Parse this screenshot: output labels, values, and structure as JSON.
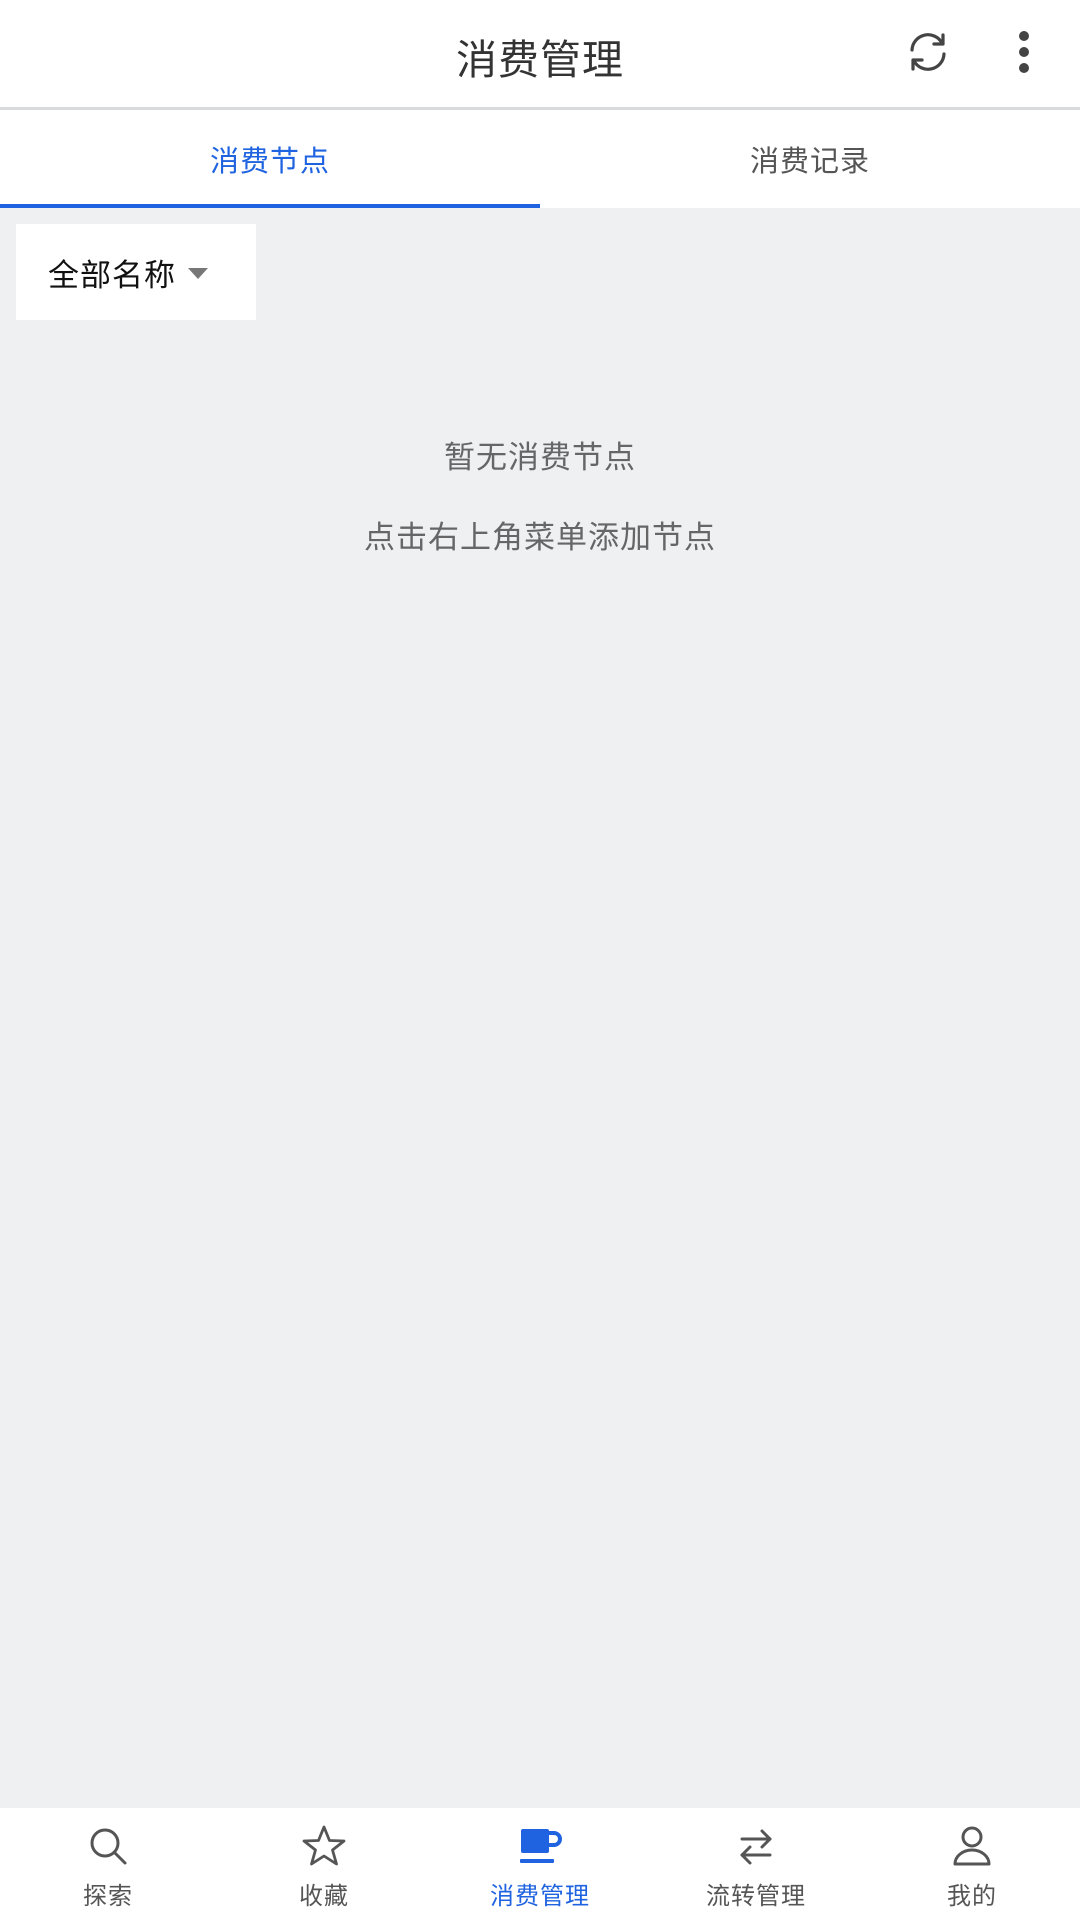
{
  "header": {
    "title": "消费管理",
    "refresh_icon": "refresh-icon",
    "more_icon": "more-vertical-icon"
  },
  "tabs": [
    {
      "label": "消费节点",
      "active": true
    },
    {
      "label": "消费记录",
      "active": false
    }
  ],
  "filter": {
    "selected": "全部名称",
    "icon": "caret-down-icon"
  },
  "empty_state": {
    "title": "暂无消费节点",
    "hint": "点击右上角菜单添加节点"
  },
  "bottom_nav": [
    {
      "label": "探索",
      "icon": "search-icon",
      "active": false
    },
    {
      "label": "收藏",
      "icon": "star-icon",
      "active": false
    },
    {
      "label": "消费管理",
      "icon": "coffee-cup-icon",
      "active": true
    },
    {
      "label": "流转管理",
      "icon": "swap-arrows-icon",
      "active": false
    },
    {
      "label": "我的",
      "icon": "user-icon",
      "active": false
    }
  ],
  "colors": {
    "accent": "#1f63e0",
    "background": "#eef0f2",
    "text_muted": "#666666"
  }
}
